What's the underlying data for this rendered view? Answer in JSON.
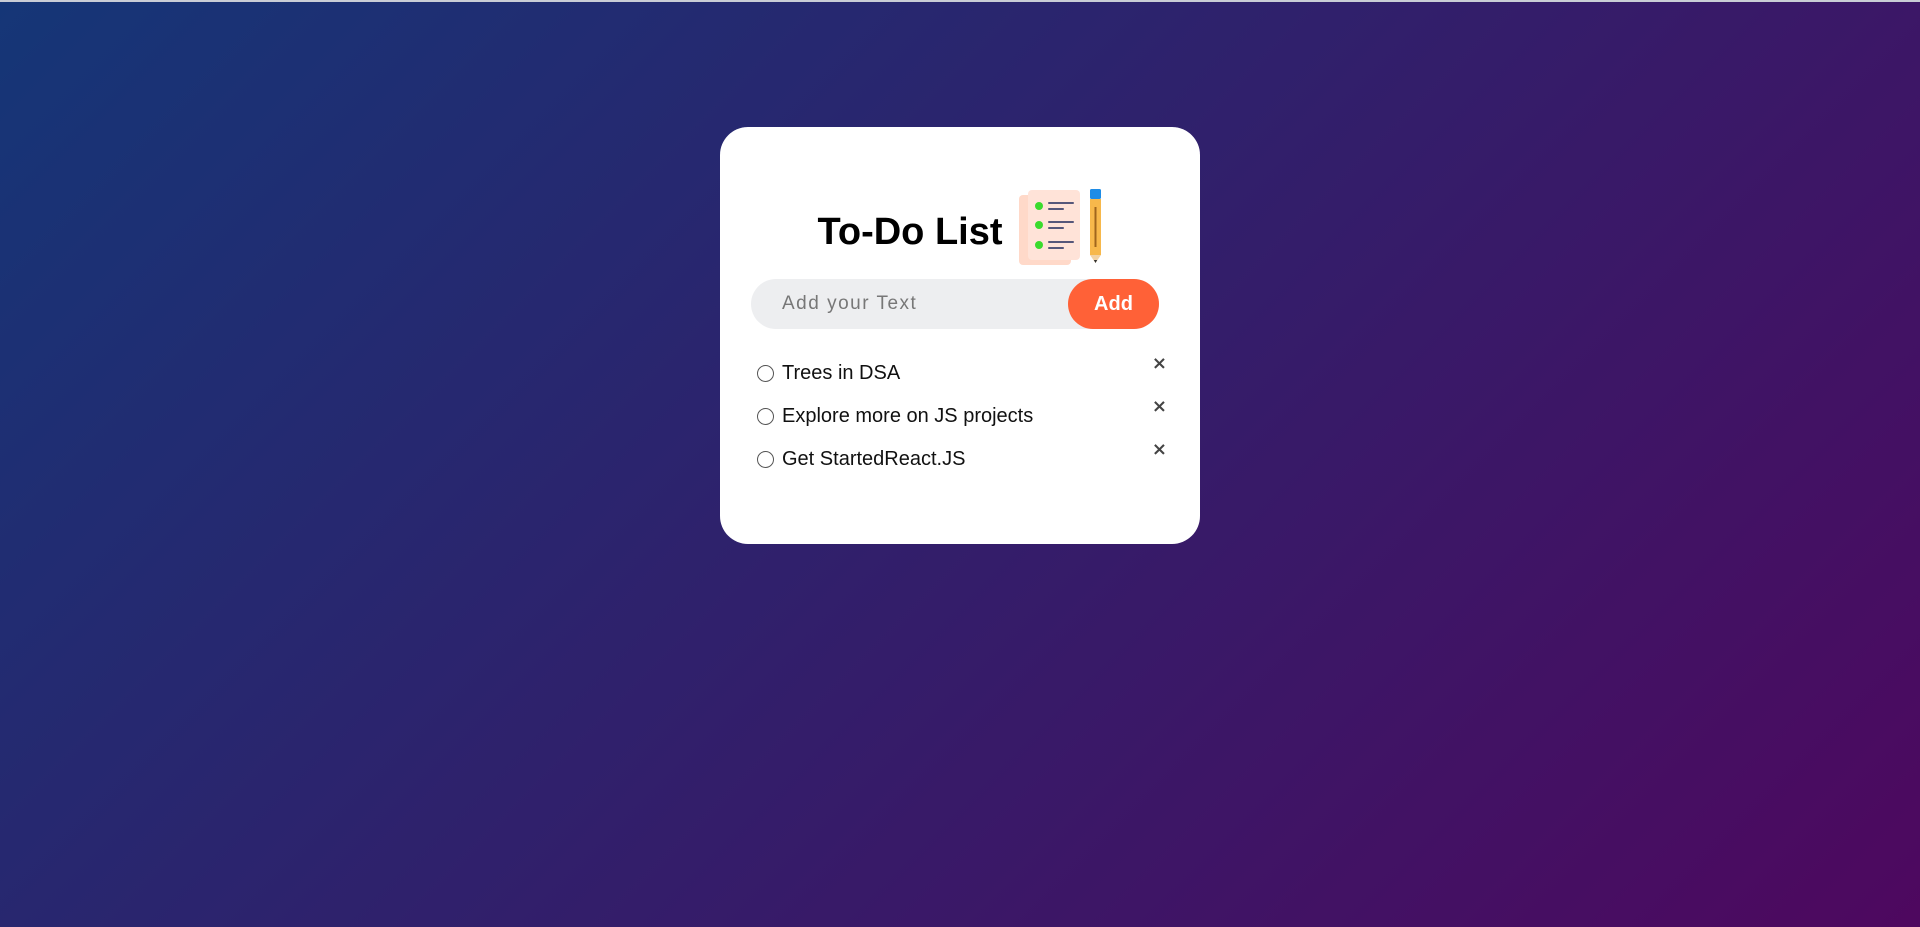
{
  "app": {
    "title": "To-Do List",
    "logo_icon": "checklist-with-pencil-icon"
  },
  "input": {
    "value": "",
    "placeholder": "Add your Text",
    "add_label": "Add"
  },
  "tasks": [
    {
      "text": "Trees in DSA",
      "checked": false,
      "delete_label": "×"
    },
    {
      "text": "Explore more on JS projects",
      "checked": false,
      "delete_label": "×"
    },
    {
      "text": "Get StartedReact.JS",
      "checked": false,
      "delete_label": "×"
    }
  ],
  "colors": {
    "background_start": "#153677",
    "background_end": "#4e085f",
    "accent": "#ff6137",
    "card": "#ffffff",
    "input_bg": "#edeef0"
  }
}
